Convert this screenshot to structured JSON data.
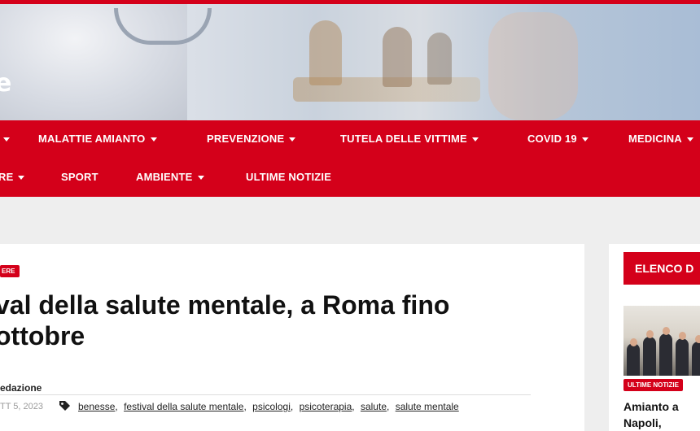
{
  "hero": {
    "logo_partial": "e"
  },
  "nav": {
    "row1": [
      {
        "label": "",
        "has_dropdown": true
      },
      {
        "label": "MALATTIE AMIANTO",
        "has_dropdown": true
      },
      {
        "label": "PREVENZIONE",
        "has_dropdown": true
      },
      {
        "label": "TUTELA DELLE VITTIME",
        "has_dropdown": true
      },
      {
        "label": "COVID 19",
        "has_dropdown": true
      },
      {
        "label": "MEDICINA",
        "has_dropdown": true
      }
    ],
    "row2": [
      {
        "label": "RE",
        "has_dropdown": true
      },
      {
        "label": "SPORT",
        "has_dropdown": false
      },
      {
        "label": "AMBIENTE",
        "has_dropdown": true
      },
      {
        "label": "ULTIME NOTIZIE",
        "has_dropdown": false
      }
    ]
  },
  "article": {
    "category": "ERE",
    "title_line1": "val della salute mentale, a Roma fino",
    "title_line2": "ottobre",
    "author": "edazione",
    "date": "TT 5, 2023",
    "tags": [
      "benesse",
      "festival della salute mentale",
      "psicologi",
      "psicoterapia",
      "salute",
      "salute mentale"
    ]
  },
  "sidebar": {
    "heading": "ELENCO D",
    "post": {
      "tag": "ULTIME NOTIZIE",
      "title_line1": "Amianto a",
      "title_line2": "Napoli,"
    }
  },
  "colors": {
    "brand_red": "#d4001a",
    "background": "#eeeeee"
  }
}
